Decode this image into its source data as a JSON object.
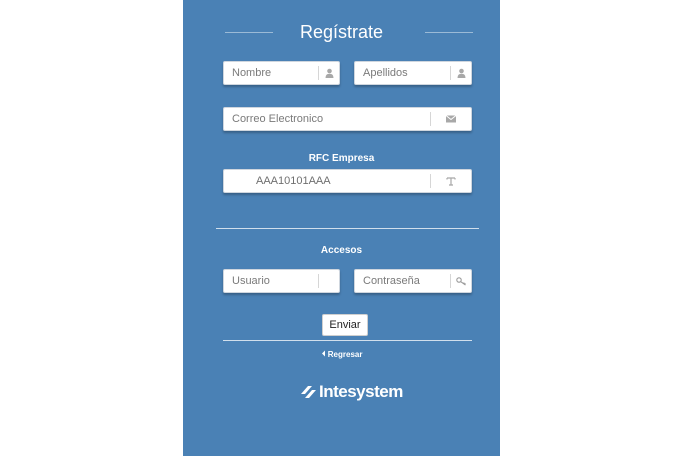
{
  "form": {
    "title": "Regístrate",
    "nombre_placeholder": "Nombre",
    "apellidos_placeholder": "Apellidos",
    "correo_placeholder": "Correo Electronico",
    "rfc_label": "RFC Empresa",
    "rfc_placeholder": "AAA10101AAA",
    "accesos_label": "Accesos",
    "usuario_placeholder": "Usuario",
    "contrasena_placeholder": "Contraseña",
    "submit_label": "Enviar",
    "back_label": "Regresar"
  },
  "brand": {
    "name": "Intesystem"
  },
  "colors": {
    "panel": "#4a81b5",
    "field": "#ffffff",
    "text_muted": "#7a7a7a"
  },
  "icons": [
    "user-icon",
    "envelope-icon",
    "text-icon",
    "key-icon",
    "chevron-left-icon",
    "logo-icon"
  ]
}
